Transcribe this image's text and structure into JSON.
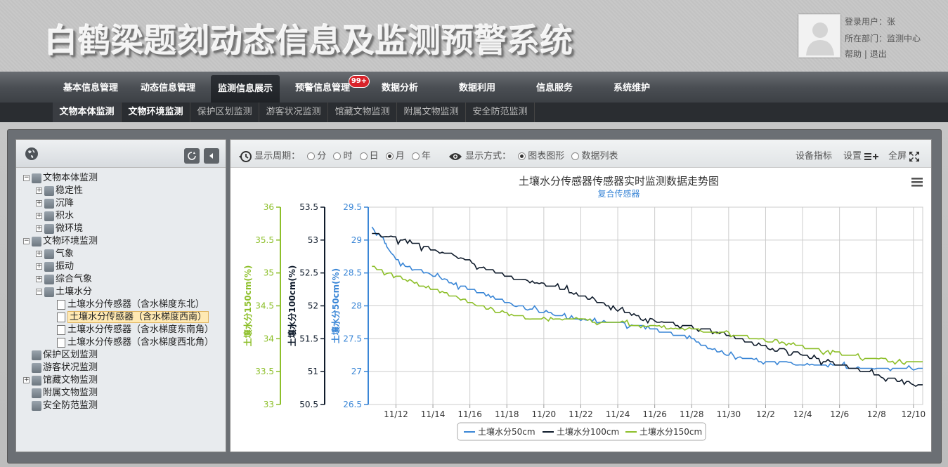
{
  "header": {
    "title": "白鹤梁题刻动态信息及监测预警系统",
    "user": {
      "login_label": "登录用户：张",
      "dept_label": "所在部门：监测中心",
      "help": "帮助",
      "sep": "|",
      "logout": "退出"
    }
  },
  "nav": {
    "items": [
      "基本信息管理",
      "动态信息管理",
      "监测信息展示",
      "预警信息管理",
      "数据分析",
      "数据利用",
      "信息服务",
      "系统维护"
    ],
    "badge": "99+"
  },
  "subnav": {
    "items": [
      "文物本体监测",
      "文物环境监测",
      "保护区划监测",
      "游客状况监测",
      "馆藏文物监测",
      "附属文物监测",
      "安全防范监测"
    ]
  },
  "tree": [
    {
      "label": "文物本体监测",
      "level": 0,
      "exp": "−",
      "icon": "folder"
    },
    {
      "label": "稳定性",
      "level": 1,
      "exp": "+",
      "icon": "folder"
    },
    {
      "label": "沉降",
      "level": 1,
      "exp": "+",
      "icon": "folder"
    },
    {
      "label": "积水",
      "level": 1,
      "exp": "+",
      "icon": "folder"
    },
    {
      "label": "微环境",
      "level": 1,
      "exp": "+",
      "icon": "folder"
    },
    {
      "label": "文物环境监测",
      "level": 0,
      "exp": "−",
      "icon": "folder"
    },
    {
      "label": "气象",
      "level": 1,
      "exp": "+",
      "icon": "folder"
    },
    {
      "label": "振动",
      "level": 1,
      "exp": "+",
      "icon": "folder"
    },
    {
      "label": "综合气象",
      "level": 1,
      "exp": "+",
      "icon": "folder"
    },
    {
      "label": "土壤水分",
      "level": 1,
      "exp": "−",
      "icon": "folder"
    },
    {
      "label": "土壤水分传感器（含水梯度东北）",
      "level": 2,
      "exp": "",
      "icon": "doc"
    },
    {
      "label": "土壤水分传感器（含水梯度西南）",
      "level": 2,
      "exp": "",
      "icon": "doc",
      "selected": true
    },
    {
      "label": "土壤水分传感器（含水梯度东南角）",
      "level": 2,
      "exp": "",
      "icon": "doc"
    },
    {
      "label": "土壤水分传感器（含水梯度西北角）",
      "level": 2,
      "exp": "",
      "icon": "doc"
    },
    {
      "label": "保护区划监测",
      "level": 0,
      "exp": "",
      "icon": "folder"
    },
    {
      "label": "游客状况监测",
      "level": 0,
      "exp": "",
      "icon": "folder"
    },
    {
      "label": "馆藏文物监测",
      "level": 0,
      "exp": "+",
      "icon": "folder"
    },
    {
      "label": "附属文物监测",
      "level": 0,
      "exp": "",
      "icon": "folder"
    },
    {
      "label": "安全防范监测",
      "level": 0,
      "exp": "",
      "icon": "folder"
    }
  ],
  "toolbar": {
    "period_label": "显示周期：",
    "periods": [
      "分",
      "时",
      "日",
      "月",
      "年"
    ],
    "period_selected": "月",
    "mode_label": "显示方式：",
    "modes": [
      "图表图形",
      "数据列表"
    ],
    "mode_selected": "图表图形",
    "device": "设备指标",
    "settings": "设置",
    "fullscreen": "全屏"
  },
  "colors": {
    "s50": "#3a86d6",
    "s100": "#0f1b2b",
    "s150": "#8dbf2a"
  },
  "chart_data": {
    "type": "line",
    "title": "土壤水分传感器传感器实时监测数据走势图",
    "subtitle": "复合传感器",
    "x_ticks": [
      "11/12",
      "11/14",
      "11/16",
      "11/18",
      "11/20",
      "11/22",
      "11/24",
      "11/26",
      "11/28",
      "11/30",
      "12/2",
      "12/4",
      "12/6",
      "12/8",
      "12/10"
    ],
    "axes": [
      {
        "label": "土壤水分150cm(%)",
        "min": 33,
        "max": 36,
        "ticks": [
          "33",
          "33.5",
          "34",
          "34.5",
          "35",
          "35.5",
          "36"
        ],
        "color": "#8dbf2a"
      },
      {
        "label": "土壤水分100cm(%)",
        "min": 50.5,
        "max": 53.5,
        "ticks": [
          "50.5",
          "51",
          "51.5",
          "52",
          "52.5",
          "53",
          "53.5"
        ],
        "color": "#0f1b2b"
      },
      {
        "label": "土壤水分50cm(%)",
        "min": 26.5,
        "max": 29.5,
        "ticks": [
          "26.5",
          "27",
          "27.5",
          "28",
          "28.5",
          "29",
          "29.5"
        ],
        "color": "#3a86d6"
      }
    ],
    "series": [
      {
        "name": "土壤水分50cm",
        "axis": 2,
        "color": "#3a86d6",
        "points": [
          [
            0.2,
            29.2
          ],
          [
            0.8,
            29.0
          ],
          [
            1.0,
            28.9
          ],
          [
            1.5,
            28.7
          ],
          [
            2.0,
            28.6
          ],
          [
            3.0,
            28.5
          ],
          [
            4.0,
            28.4
          ],
          [
            5.0,
            28.3
          ],
          [
            6.0,
            28.2
          ],
          [
            7.0,
            28.1
          ],
          [
            8.0,
            28.0
          ],
          [
            9.5,
            27.9
          ],
          [
            11.5,
            27.8
          ],
          [
            13.0,
            27.75
          ],
          [
            14.5,
            27.7
          ],
          [
            16.0,
            27.6
          ],
          [
            17.5,
            27.5
          ],
          [
            18.0,
            27.4
          ],
          [
            19.0,
            27.3
          ],
          [
            20.0,
            27.2
          ],
          [
            22.0,
            27.15
          ],
          [
            24.0,
            27.1
          ],
          [
            27.5,
            27.05
          ],
          [
            30.0,
            27.05
          ]
        ]
      },
      {
        "name": "土壤水分100cm",
        "axis": 1,
        "color": "#0f1b2b",
        "points": [
          [
            0.2,
            53.1
          ],
          [
            2.0,
            53.0
          ],
          [
            3.0,
            52.9
          ],
          [
            4.0,
            52.8
          ],
          [
            5.0,
            52.75
          ],
          [
            6.0,
            52.6
          ],
          [
            7.0,
            52.5
          ],
          [
            8.0,
            52.4
          ],
          [
            10.0,
            52.3
          ],
          [
            11.0,
            52.2
          ],
          [
            12.0,
            52.1
          ],
          [
            13.0,
            52.0
          ],
          [
            14.0,
            51.9
          ],
          [
            15.0,
            51.8
          ],
          [
            17.0,
            51.7
          ],
          [
            19.0,
            51.6
          ],
          [
            20.0,
            51.5
          ],
          [
            21.0,
            51.4
          ],
          [
            23.0,
            51.3
          ],
          [
            24.0,
            51.2
          ],
          [
            25.5,
            51.1
          ],
          [
            27.0,
            51.0
          ],
          [
            28.0,
            50.9
          ],
          [
            30.0,
            50.8
          ]
        ]
      },
      {
        "name": "土壤水分150cm",
        "axis": 0,
        "color": "#8dbf2a",
        "points": [
          [
            0.2,
            35.1
          ],
          [
            1.0,
            35.0
          ],
          [
            2.0,
            34.9
          ],
          [
            3.0,
            34.8
          ],
          [
            4.0,
            34.7
          ],
          [
            6.0,
            34.5
          ],
          [
            7.0,
            34.4
          ],
          [
            9.0,
            34.3
          ],
          [
            11.0,
            34.3
          ],
          [
            13.0,
            34.25
          ],
          [
            15.0,
            34.2
          ],
          [
            17.0,
            34.15
          ],
          [
            19.0,
            34.1
          ],
          [
            21.0,
            34.0
          ],
          [
            23.0,
            33.9
          ],
          [
            25.0,
            33.8
          ],
          [
            27.0,
            33.7
          ],
          [
            29.0,
            33.65
          ],
          [
            30.0,
            33.65
          ]
        ]
      }
    ],
    "legend": "bottom-center",
    "grid": true
  }
}
